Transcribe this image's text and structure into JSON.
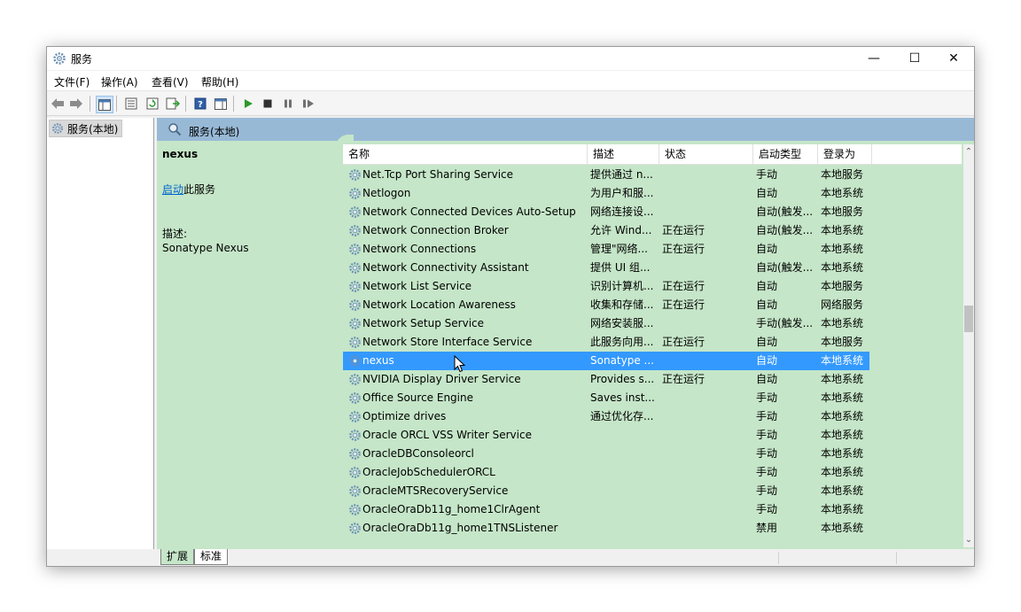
{
  "window": {
    "title": "服务",
    "controls": {
      "minimize": "—",
      "maximize": "☐",
      "close": "✕"
    }
  },
  "menu": [
    {
      "label": "文件(F)"
    },
    {
      "label": "操作(A)"
    },
    {
      "label": "查看(V)"
    },
    {
      "label": "帮助(H)"
    }
  ],
  "tree": {
    "root_label": "服务(本地)"
  },
  "main": {
    "header_title": "服务(本地)",
    "detail": {
      "service_name": "nexus",
      "start_link": "启动",
      "start_suffix": "此服务",
      "desc_label": "描述:",
      "desc_value": "Sonatype Nexus"
    },
    "columns": {
      "name": "名称",
      "desc": "描述",
      "status": "状态",
      "startup": "启动类型",
      "logon": "登录为"
    },
    "rows": [
      {
        "name": "Net.Tcp Port Sharing Service",
        "desc": "提供通过 n...",
        "status": "",
        "startup": "手动",
        "logon": "本地服务"
      },
      {
        "name": "Netlogon",
        "desc": "为用户和服...",
        "status": "",
        "startup": "自动",
        "logon": "本地系统"
      },
      {
        "name": "Network Connected Devices Auto-Setup",
        "desc": "网络连接设...",
        "status": "",
        "startup": "自动(触发...",
        "logon": "本地服务"
      },
      {
        "name": "Network Connection Broker",
        "desc": "允许 Wind...",
        "status": "正在运行",
        "startup": "自动(触发...",
        "logon": "本地系统"
      },
      {
        "name": "Network Connections",
        "desc": "管理\"网络...",
        "status": "正在运行",
        "startup": "自动",
        "logon": "本地系统"
      },
      {
        "name": "Network Connectivity Assistant",
        "desc": "提供 UI 组...",
        "status": "",
        "startup": "自动(触发...",
        "logon": "本地系统"
      },
      {
        "name": "Network List Service",
        "desc": "识别计算机...",
        "status": "正在运行",
        "startup": "自动",
        "logon": "本地服务"
      },
      {
        "name": "Network Location Awareness",
        "desc": "收集和存储...",
        "status": "正在运行",
        "startup": "自动",
        "logon": "网络服务"
      },
      {
        "name": "Network Setup Service",
        "desc": "网络安装服...",
        "status": "",
        "startup": "手动(触发...",
        "logon": "本地系统"
      },
      {
        "name": "Network Store Interface Service",
        "desc": "此服务向用...",
        "status": "正在运行",
        "startup": "自动",
        "logon": "本地服务"
      },
      {
        "name": "nexus",
        "desc": "Sonatype ...",
        "status": "",
        "startup": "自动",
        "logon": "本地系统"
      },
      {
        "name": "NVIDIA Display Driver Service",
        "desc": "Provides s...",
        "status": "正在运行",
        "startup": "自动",
        "logon": "本地系统"
      },
      {
        "name": "Office  Source Engine",
        "desc": "Saves inst...",
        "status": "",
        "startup": "手动",
        "logon": "本地系统"
      },
      {
        "name": "Optimize drives",
        "desc": "通过优化存...",
        "status": "",
        "startup": "手动",
        "logon": "本地系统"
      },
      {
        "name": "Oracle ORCL VSS Writer Service",
        "desc": "",
        "status": "",
        "startup": "手动",
        "logon": "本地系统"
      },
      {
        "name": "OracleDBConsoleorcl",
        "desc": "",
        "status": "",
        "startup": "手动",
        "logon": "本地系统"
      },
      {
        "name": "OracleJobSchedulerORCL",
        "desc": "",
        "status": "",
        "startup": "手动",
        "logon": "本地系统"
      },
      {
        "name": "OracleMTSRecoveryService",
        "desc": "",
        "status": "",
        "startup": "手动",
        "logon": "本地系统"
      },
      {
        "name": "OracleOraDb11g_home1ClrAgent",
        "desc": "",
        "status": "",
        "startup": "手动",
        "logon": "本地系统"
      },
      {
        "name": "OracleOraDb11g_home1TNSListener",
        "desc": "",
        "status": "",
        "startup": "禁用",
        "logon": "本地系统"
      }
    ],
    "selected_row": 10
  },
  "tabs": [
    {
      "label": "扩展"
    },
    {
      "label": "标准"
    }
  ],
  "colors": {
    "list_bg": "#c5e6c8",
    "header_bg": "#98b9d6",
    "selection": "#3399ff",
    "link": "#0066cc"
  }
}
